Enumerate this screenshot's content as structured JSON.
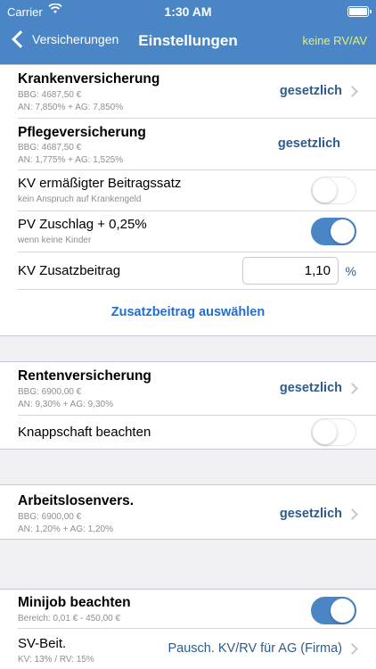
{
  "status": {
    "carrier": "Carrier",
    "wifi_icon": "wifi-icon",
    "time": "1:30 AM",
    "battery_icon": "battery-icon"
  },
  "nav": {
    "back_label": "Versicherungen",
    "title": "Einstellungen",
    "right_label": "keine RV/AV"
  },
  "kv": {
    "title": "Krankenversicherung",
    "bbg": "BBG: 4687,50 €",
    "rates": "AN: 7,850% + AG: 7,850%",
    "value": "gesetzlich"
  },
  "pv": {
    "title": "Pflegeversicherung",
    "bbg": "BBG: 4687,50 €",
    "rates": "AN: 1,775% + AG: 1,525%",
    "value": "gesetzlich"
  },
  "kv_ermaessigt": {
    "title": "KV ermäßigter Beitragssatz",
    "sub": "kein Anspruch auf Krankengeld",
    "on": false
  },
  "pv_zuschlag": {
    "title": "PV Zuschlag + 0,25%",
    "sub": "wenn keine Kinder",
    "on": true
  },
  "kv_zusatz": {
    "title": "KV Zusatzbeitrag",
    "value": "1,10",
    "unit": "%"
  },
  "zusatz_link": "Zusatzbeitrag auswählen",
  "rv": {
    "title": "Rentenversicherung",
    "bbg": "BBG: 6900,00 €",
    "rates": "AN: 9,30% + AG: 9,30%",
    "value": "gesetzlich"
  },
  "knappschaft": {
    "title": "Knappschaft beachten",
    "on": false
  },
  "av": {
    "title": "Arbeitslosenvers.",
    "bbg": "BBG: 6900,00 €",
    "rates": "AN: 1,20% + AG: 1,20%",
    "value": "gesetzlich"
  },
  "minijob": {
    "title": "Minijob beachten",
    "sub": "Bereich: 0,01 € - 450,00 €",
    "on": true
  },
  "svbeit": {
    "title": "SV-Beit.",
    "sub": "KV: 13% / RV: 15%",
    "value": "Pausch. KV/RV für AG (Firma)"
  },
  "colors": {
    "nav_bg": "#4a86c6",
    "accent": "#4a86c6",
    "value_text": "#2c5c8c",
    "link": "#1f6fd0",
    "right_label": "#e8f06a"
  }
}
